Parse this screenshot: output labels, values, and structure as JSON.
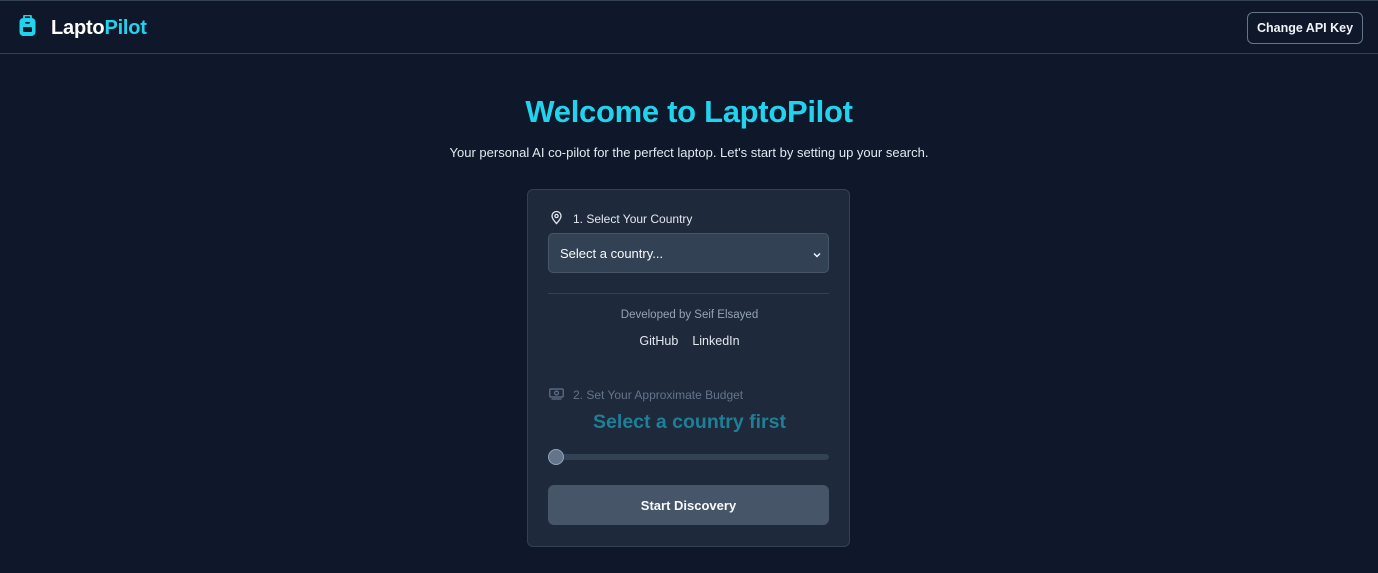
{
  "header": {
    "brand_part1": "Lapto",
    "brand_part2": "Pilot",
    "brand_icon": "backpack-icon",
    "api_button": "Change API Key"
  },
  "hero": {
    "title": "Welcome to LaptoPilot",
    "subtitle": "Your personal AI co-pilot for the perfect laptop. Let's start by setting up your search."
  },
  "form": {
    "country_label": "1. Select Your Country",
    "country_icon": "map-pin-icon",
    "country_select_value": "Select a country...",
    "developer_text": "Developed by Seif Elsayed",
    "links": [
      "GitHub",
      "LinkedIn"
    ],
    "budget_label": "2. Set Your Approximate Budget",
    "budget_icon": "banknote-icon",
    "budget_placeholder": "Select a country first",
    "budget_slider_level": 0,
    "start_button": "Start Discovery"
  },
  "colors": {
    "background": "#0f172a",
    "card": "#1e293b",
    "accent": "#22d3ee",
    "button": "#475569"
  }
}
